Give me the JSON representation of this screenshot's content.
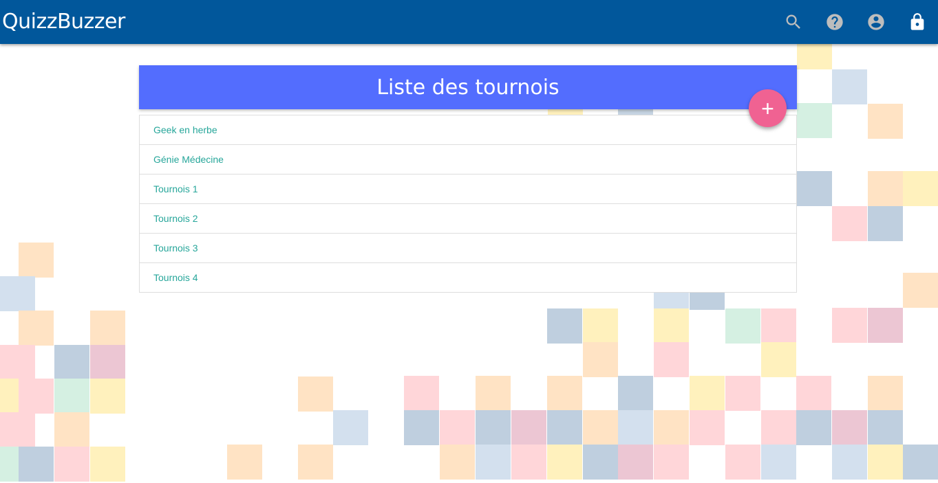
{
  "app": {
    "title": "QuizzBuzzer"
  },
  "toolbar": {
    "icons": [
      "search-icon",
      "help-icon",
      "account-icon",
      "lock-icon"
    ]
  },
  "card": {
    "title": "Liste des tournois",
    "add_button_label": "+",
    "items": [
      {
        "label": "Geek en herbe"
      },
      {
        "label": "Génie Médecine"
      },
      {
        "label": "Tournois 1"
      },
      {
        "label": "Tournois 2"
      },
      {
        "label": "Tournois 3"
      },
      {
        "label": "Tournois 4"
      }
    ]
  },
  "colors": {
    "topbar": "#01579b",
    "header": "#536dfe",
    "fab": "#f06292",
    "link": "#26a69a"
  }
}
